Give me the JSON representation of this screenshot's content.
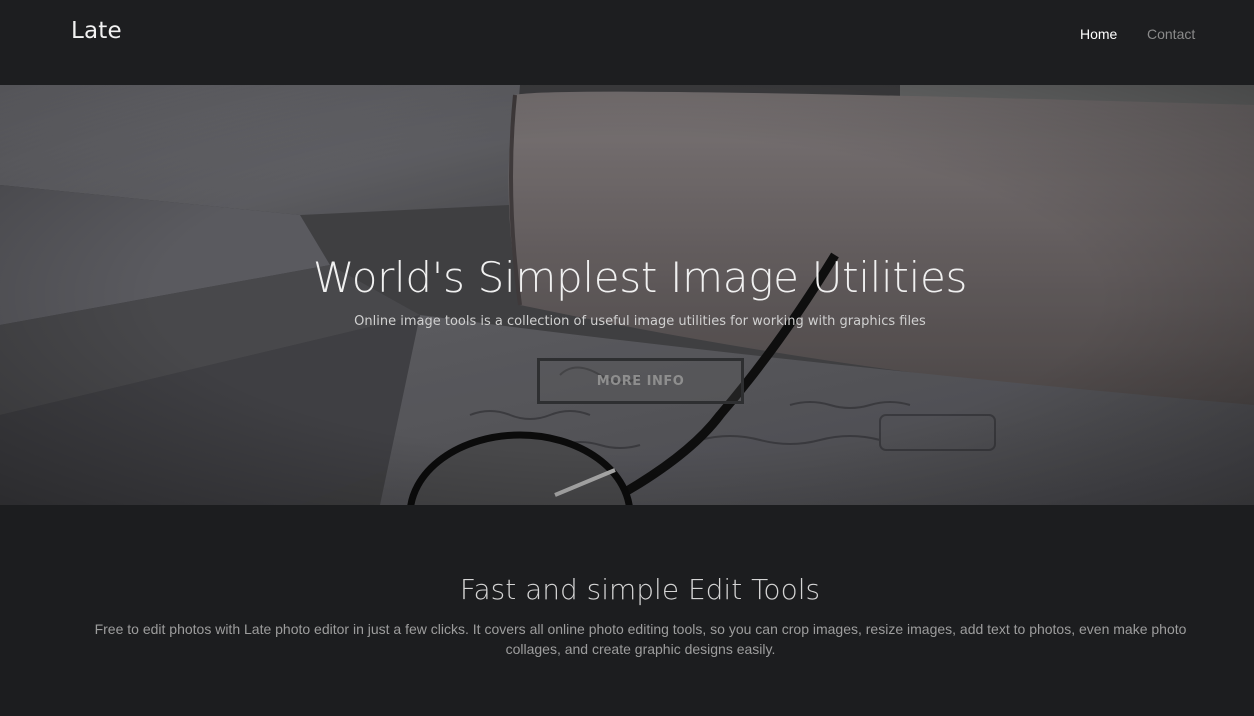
{
  "navbar": {
    "brand": "Late",
    "links": [
      {
        "label": "Home",
        "active": true
      },
      {
        "label": "Contact",
        "active": false
      }
    ]
  },
  "hero": {
    "title": "World's Simplest Image Utilities",
    "subtitle": "Online image tools is a collection of useful image utilities for working with graphics files",
    "button_label": "MORE INFO"
  },
  "features": {
    "title": "Fast and simple Edit Tools",
    "description": "Free to edit photos with Late photo editor in just a few clicks. It covers all online photo editing tools, so you can crop images, resize images, add text to photos, even make photo collages, and create graphic designs easily."
  },
  "colors": {
    "background": "#1c1d1f",
    "navbar": "#1d1e20",
    "nav_active": "#ffffff",
    "nav_inactive": "#8a8a8a"
  }
}
